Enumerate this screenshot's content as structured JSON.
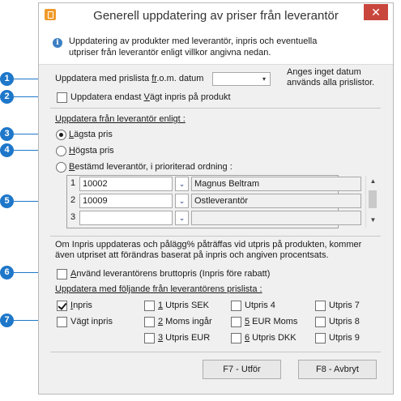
{
  "window": {
    "title": "Generell uppdatering av priser från leverantör",
    "close_glyph": "✕",
    "info_text": "Uppdatering av produkter med leverantör, inpris och eventuella utpriser från leverantör enligt villkor angivna nedan."
  },
  "date": {
    "label_before": "Uppdatera med prislista ",
    "label_u": "fr",
    "label_after": ".o.m. datum",
    "value": "",
    "note": "Anges inget datum används alla prislistor."
  },
  "only_real": {
    "label_before": "Uppdatera endast ",
    "label_u": "V",
    "label_after": "ägt inpris på produkt",
    "checked": false
  },
  "supplier_section": {
    "heading": "Uppdatera från leverantör enligt :",
    "lowest": {
      "label_u": "L",
      "label_after": "ägsta pris",
      "checked": true
    },
    "highest": {
      "label_u": "H",
      "label_after": "ögsta pris",
      "checked": false
    },
    "specific": {
      "label_u": "B",
      "label_after": "estämd leverantör, i prioriterad ordning :",
      "checked": false
    },
    "rows": [
      {
        "num": "1",
        "code": "10002",
        "name": "Magnus Beltram"
      },
      {
        "num": "2",
        "code": "10009",
        "name": "Ostleverantör"
      },
      {
        "num": "3",
        "code": "",
        "name": ""
      }
    ]
  },
  "note_text": "Om Inpris uppdateras och pålägg% påträffas vid utpris på produkten, kommer även utpriset att förändras baserat på inpris och angiven procentsats.",
  "gross": {
    "label_u": "A",
    "label_after": "nvänd leverantörens bruttopris (Inpris före rabatt)",
    "checked": false
  },
  "pricelist_section": {
    "heading": "Uppdatera med följande från leverantörens prislista :",
    "col1": [
      {
        "u": "I",
        "rest": "npris",
        "checked": true
      },
      {
        "u": "",
        "rest": "Vägt inpris",
        "checked": false
      }
    ],
    "col2": [
      {
        "u": "1",
        "rest": " Utpris SEK",
        "checked": false
      },
      {
        "u": "2",
        "rest": " Moms ingår",
        "checked": false
      },
      {
        "u": "3",
        "rest": " Utpris EUR",
        "checked": false
      }
    ],
    "col3": [
      {
        "u": "Utpris 4",
        "rest": "",
        "checked": false
      },
      {
        "u": "5",
        "rest": " EUR Moms",
        "checked": false
      },
      {
        "u": "6",
        "rest": " Utpris DKK",
        "checked": false
      }
    ],
    "col4": [
      {
        "u": "Utpris 7",
        "rest": "",
        "checked": false
      },
      {
        "u": "Utpris 8",
        "rest": "",
        "checked": false
      },
      {
        "u": "Utpris 9",
        "rest": "",
        "checked": false
      }
    ]
  },
  "buttons": {
    "run": "F7 - Utför",
    "cancel": "F8 - Avbryt"
  },
  "callouts": [
    "1",
    "2",
    "3",
    "4",
    "5",
    "6",
    "7"
  ],
  "colors": {
    "callout": "#1e77c9",
    "close": "#c9463d",
    "app_icon": "#f09a2b"
  }
}
